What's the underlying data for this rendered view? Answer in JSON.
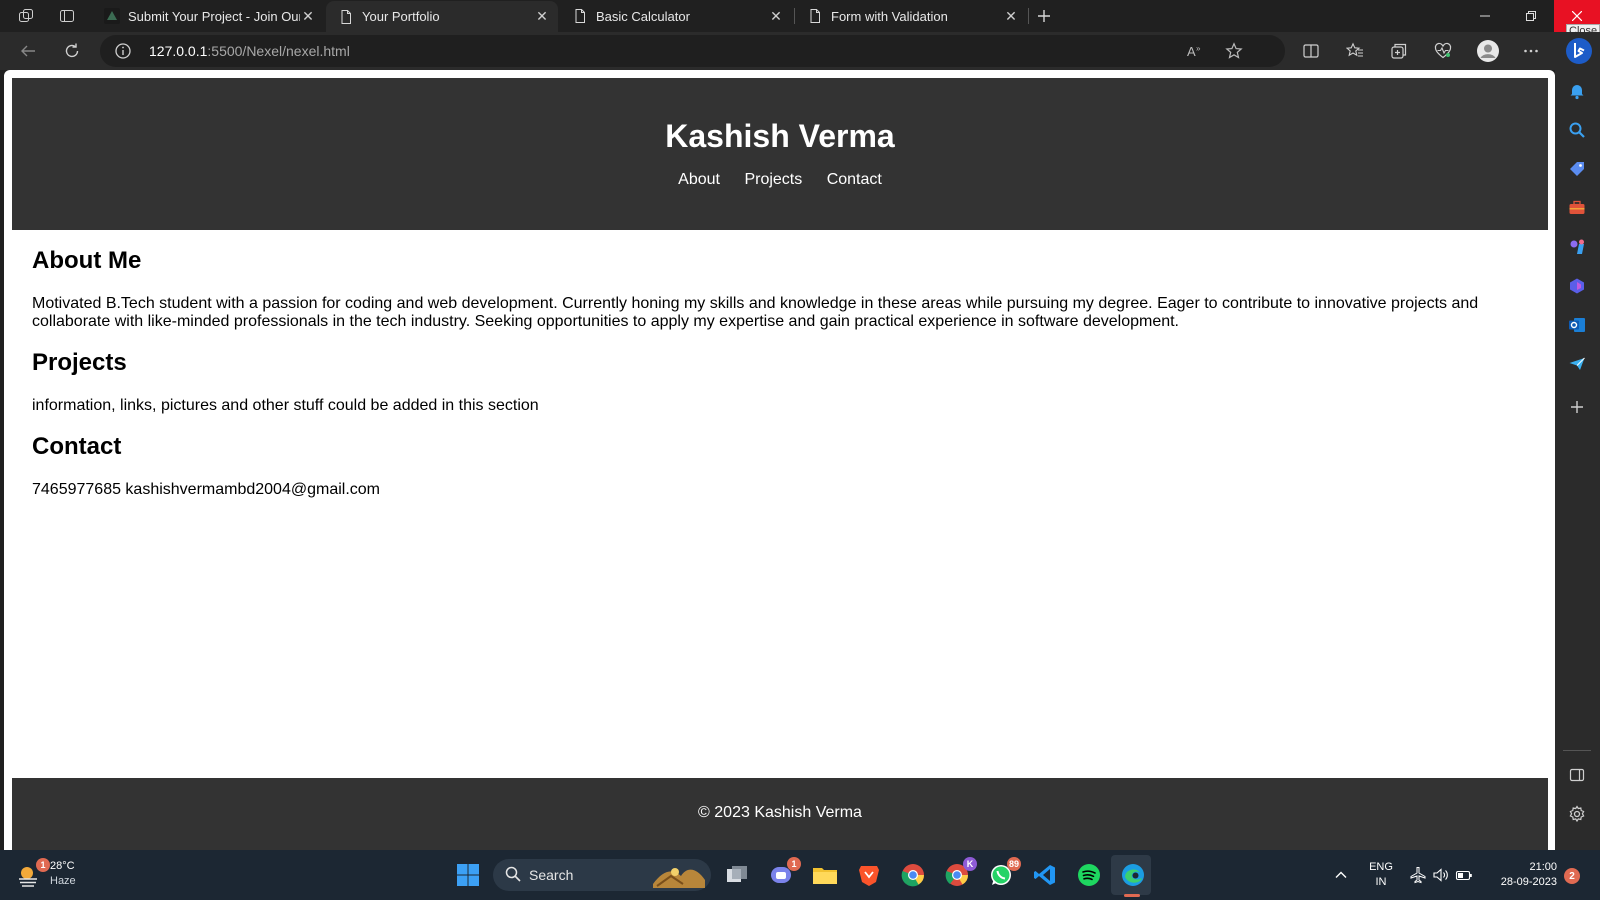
{
  "browser": {
    "tabs": [
      {
        "title": "Submit Your Project - Join Our Te",
        "active": false
      },
      {
        "title": "Your Portfolio",
        "active": true
      },
      {
        "title": "Basic Calculator",
        "active": false
      },
      {
        "title": "Form with Validation",
        "active": false
      }
    ],
    "close_tooltip": "Close",
    "address": {
      "host": "127.0.0.1",
      "rest": ":5500/Nexel/nexel.html"
    }
  },
  "page": {
    "header": {
      "title": "Kashish Verma",
      "nav": [
        "About",
        "Projects",
        "Contact"
      ]
    },
    "sections": [
      {
        "heading": "About Me",
        "body": "Motivated B.Tech student with a passion for coding and web development. Currently honing my skills and knowledge in these areas while pursuing my degree. Eager to contribute to innovative projects and collaborate with like-minded professionals in the tech industry. Seeking opportunities to apply my expertise and gain practical experience in software development."
      },
      {
        "heading": "Projects",
        "body": "information, links, pictures and other stuff could be added in this section"
      },
      {
        "heading": "Contact",
        "body": "7465977685 kashishvermambd2004@gmail.com"
      }
    ],
    "footer": "© 2023 Kashish Verma"
  },
  "taskbar": {
    "weather": {
      "temp": "28°C",
      "condition": "Haze",
      "badge": "1"
    },
    "search_label": "Search",
    "teams_badge": "1",
    "chrome_profile": "K",
    "whatsapp_badge": "89",
    "language": {
      "line1": "ENG",
      "line2": "IN"
    },
    "clock": {
      "time": "21:00",
      "date": "28-09-2023"
    },
    "notifications": "2"
  },
  "colors": {
    "header_bg": "#333333",
    "taskbar_bg": "#1c2733",
    "close_red": "#e81123"
  }
}
